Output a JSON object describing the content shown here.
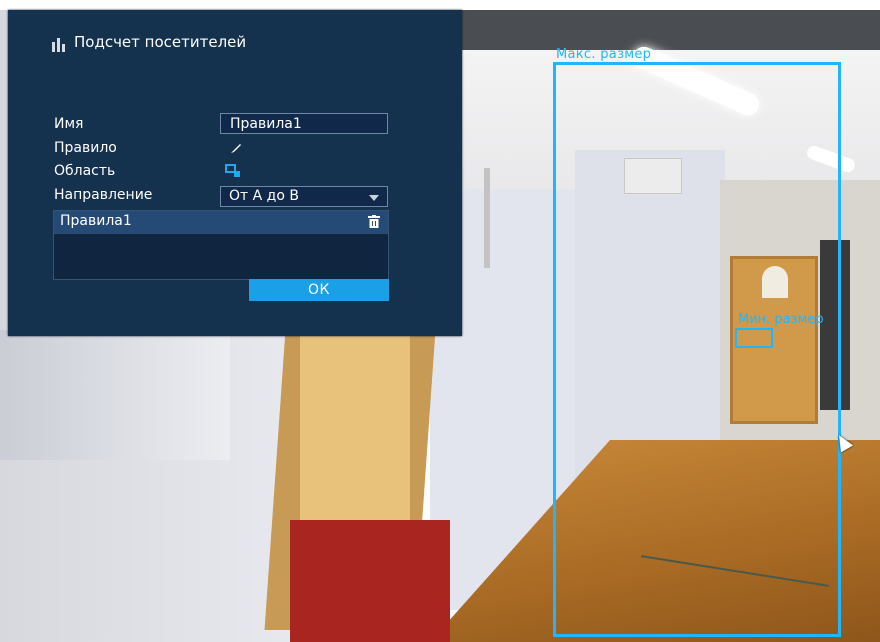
{
  "dialog": {
    "title": "Подсчет посетителей",
    "fields": {
      "name_label": "Имя",
      "name_value": "Правила1",
      "rule_label": "Правило",
      "area_label": "Область",
      "direction_label": "Направление",
      "direction_value": "От А до В"
    },
    "rules": [
      "Правила1"
    ],
    "ok_label": "ОК"
  },
  "overlay": {
    "max_size_label": "Макс. размер",
    "min_size_label": "Мин. размер",
    "color": "#1fb6ff"
  },
  "colors": {
    "panel_bg": "#14314d",
    "accent": "#1aa0e6",
    "selected_row": "#244a75"
  },
  "icons": [
    "visitor-counter-icon",
    "pencil-icon",
    "area-icon",
    "chevron-down-icon",
    "trash-icon",
    "mouse-cursor-icon"
  ]
}
